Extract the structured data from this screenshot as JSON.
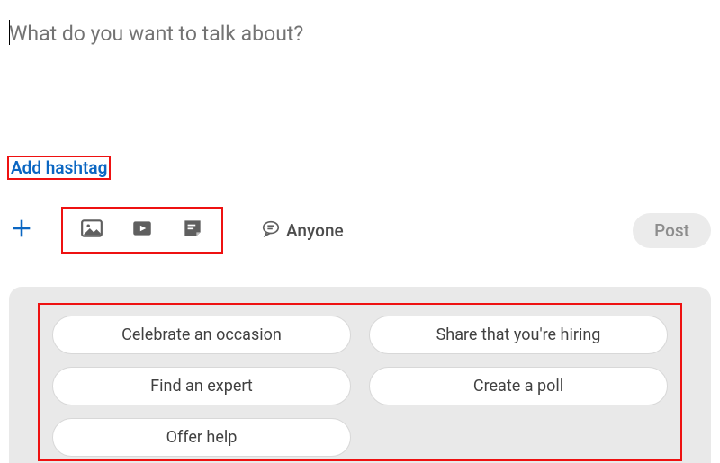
{
  "composer": {
    "placeholder": "What do you want to talk about?"
  },
  "hashtag": {
    "label": "Add hashtag"
  },
  "toolbar": {
    "audience_label": "Anyone",
    "post_label": "Post"
  },
  "suggestions": {
    "items": [
      "Celebrate an occasion",
      "Share that you're hiring",
      "Find an expert",
      "Create a poll",
      "Offer help"
    ]
  },
  "icons": {
    "plus": "plus-icon",
    "photo": "photo-icon",
    "video": "video-icon",
    "article": "document-icon",
    "comment": "comment-icon"
  }
}
